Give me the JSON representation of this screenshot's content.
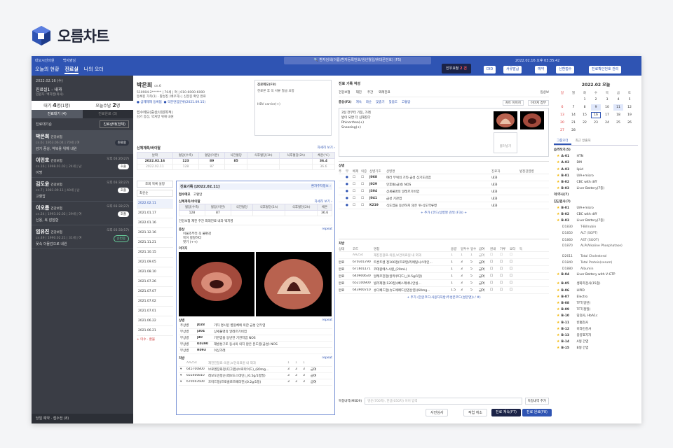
{
  "brand": {
    "name": "오름차트",
    "colors": {
      "primary": "#2f54b3",
      "dark": "#3a3d45"
    }
  },
  "topbar": {
    "hospital": "대오시선의원",
    "user": "백지영님",
    "tabs": [
      "오늘의 현황",
      "진료실",
      "나의 오더"
    ],
    "active_tab": "진료실",
    "search_placeholder": "🔍 환자검색(이름/환자등록번호/생년월일/휴대폰번호) (F5)",
    "time": "2022.02.16 오후 03:35:42",
    "emergency_prefix": "인우요청",
    "emergency_count": "2 건",
    "buttons": [
      "DID",
      "서류발급",
      "예약",
      "신환접수",
      "진료확인번호 관리"
    ]
  },
  "sidebar": {
    "date": "2022.02.16 (수)",
    "room": "진료실1 - 내과",
    "room_sub": "입원자: 백지영(의사)",
    "counts": [
      {
        "label": "대기",
        "value": "4",
        "suffix": "명",
        "extra": "(1명)"
      },
      {
        "label": "오늘수납",
        "value": "2",
        "suffix": "명"
      }
    ],
    "tabs": [
      "진료대기 (4)",
      "진료완료 (3)"
    ],
    "filter_label": "진료대기순",
    "filter_select": "진료상태(전체)",
    "patients": [
      {
        "name": "박은희",
        "ins": "건강보험",
        "info": "cn.6 | 1953.06.04 | 70세 | 여",
        "dx": "감기 증상, 약복용 위해 내원",
        "time": "",
        "badge": "진료중",
        "style": "dk"
      },
      {
        "name": "이민호",
        "ins": "건강보험",
        "info": "cn.16 | 1998.01.02 | 24세 | 남",
        "dx": "이명",
        "time": "오후 03:20(27)",
        "badge": "호출",
        "style": ""
      },
      {
        "name": "김도윤",
        "ins": "건강보험",
        "info": "cn.7 | 1981.09.11 | 40세 | 남",
        "dx": "고혈압",
        "time": "오후 03:32(27)",
        "badge": "호출",
        "style": ""
      },
      {
        "name": "이오름",
        "ins": "건강보험",
        "info": "cn.24 | 1993.02.02 | 29세 | 여",
        "dx": "신용, 복 잡잡함",
        "time": "오후 03:32(27)",
        "badge": "호출",
        "style": ""
      },
      {
        "name": "임유진",
        "ins": "건강보험",
        "info": "cn.49 | 1990.02.21 | 31세 | 여",
        "dx": "꽃속 이물감으로 내원",
        "time": "오후 03:33(17)",
        "badge": "순번중",
        "style": "ol"
      }
    ],
    "footer": "당일 예약 · 접수전 (8)"
  },
  "patient": {
    "name": "박은희",
    "cn": "cn.6",
    "line1": "510904-2****** | 70세 | 여 | 010-6000-6000",
    "line2": "등록된 가족(1) · 활성진 (배우자) | 신분증 확인 완료",
    "tags": [
      "금제제재 등록됨",
      "약분면임분류(2021.09.15)"
    ],
    "memo_label": "진료메모(F8)",
    "memo_text": "진료본 후 꼭 서류 발급 요청",
    "hbv": "HBV carrier(+)",
    "symptom_label": "접수메모(증상/내원목적)",
    "symptom": "감기 증상, 약처방 위해 내원"
  },
  "vitals": {
    "title": "신체계측/바이탈",
    "link": "자세히 보기 ›",
    "headers": [
      "날짜",
      "혈압(수축)",
      "혈압(이완)",
      "식전혈당",
      "식후혈당(1h)",
      "식후혈당(2h)",
      "체온(℃)"
    ],
    "rows": [
      [
        "2022.02.16",
        "123",
        "89",
        "85",
        "",
        "",
        "36.4"
      ],
      [
        "2022.02.11",
        "128",
        "87",
        "",
        "",
        "",
        "36.6"
      ]
    ]
  },
  "history": {
    "btn": "조회 목록 설정",
    "sort": "최신순",
    "dates": [
      "2022.02.11",
      "2021.01.17",
      "2022.01.16",
      "2021.12.16",
      "2021.11.21",
      "2021.10.15",
      "2021.09.05",
      "2021.08.10",
      "2021.07.26",
      "2021.07.07",
      "2021.07.02",
      "2021.07.01",
      "2021.06.22",
      "2021.06.21"
    ],
    "footer": "+ 미수 · 환불"
  },
  "record": {
    "title": "진료기록 [2022.02.11]",
    "link": "환자주차정보 ›",
    "memo_label": "접수메모",
    "memo": "고혈압",
    "vital_title": "신체계측/바이탈",
    "vital_link": "자세히 보기 ›",
    "vital_headers": [
      "혈압(수축)",
      "혈압(이완)",
      "식전혈당",
      "식후혈당(1h)",
      "식후혈당(2h)",
      "체온"
    ],
    "vital_row": [
      "128",
      "87",
      "",
      "",
      "",
      "36.6"
    ],
    "ins_line": "건강보험 재진 주간 외래진료 내과 백지영",
    "sx_label": "증상",
    "sx_repeat": "repeat",
    "sx": [
      "이물조부터 꼭 불편감",
      "목이 칼칼하다",
      "핏기 (++)"
    ],
    "img_label": "이미지",
    "dx_label": "상병",
    "dx_repeat": "repeat",
    "dx": [
      [
        "주상병",
        "J028",
        "기타 명시된 병원체에 의한 급성 인두염"
      ],
      [
        "부상병",
        "J304",
        "상세불명의 알레르기비염"
      ],
      [
        "부상병",
        "J40",
        "기관염을 동반한 기관지염 NOS"
      ],
      [
        "부상병",
        "K0390",
        "재발성구토 동시의 의지 않은 분도염(급성) NOS"
      ],
      [
        "부상병",
        "R093",
        "이상가래"
      ]
    ],
    "rx_label": "처방",
    "rx_repeat": "repeat",
    "rx": [
      [
        "",
        "AA254",
        "재진진찰료-의원,보건의료원 내 외과",
        "1",
        "1",
        "1",
        ""
      ],
      [
        "▾",
        "645700800",
        "브로멘장화정(디그램)(브로마이드)_(80mg...",
        "3",
        "3",
        "3",
        "급여"
      ],
      [
        "▾",
        "655400810",
        "레보도민정순(레보도스데민)_(0.5g/1정발)",
        "3",
        "3",
        "3",
        "급여"
      ],
      [
        "▾",
        "670503500",
        "흐미드정(프로클로르페라진)(0.2g/1정)",
        "3",
        "3",
        "3",
        "급여"
      ]
    ]
  },
  "note": {
    "title": "진료 기록 작성",
    "ins": "건강보험",
    "visit": "재진",
    "time": "주간",
    "dept": "외래진료",
    "doc": "임상보",
    "sx_label": "증상(F2)",
    "sx_toolbar": [
      "계속",
      "화순",
      "맞춤기",
      "맞춤도",
      "고혈압"
    ],
    "sx": [
      "3일 전부터 기침, 가래",
      "밤이 되면 더 심해진다",
      "Rhinorrhea(+)",
      "Sneezing(+)"
    ],
    "chart_btn": "차트 이미지",
    "img_btn": "이미지 첨부",
    "attach": "불러넣기",
    "dx_label": "상병",
    "dx_headers": [
      "주",
      "부",
      "배제",
      "의증",
      "상병기호",
      "상병명",
      "진료과",
      "법정감염병"
    ],
    "dx": [
      [
        "●",
        "J068",
        "여러 부위의 기타 급성 상기도감염",
        "내과"
      ],
      [
        "●",
        "J029",
        "인후통(급성) NOS",
        "내과"
      ],
      [
        "●",
        "J304",
        "상세불명의 알레르기비염",
        "내과"
      ],
      [
        "●",
        "J041",
        "급성 기관염",
        "내과"
      ],
      [
        "●",
        "K219",
        "식도염을 동반하지 않은 위-식도역류병",
        "내과"
      ]
    ],
    "dx_add": "+ 추가 (코드/상병명 검색 (F3)) +",
    "rx_label": "처방",
    "rx_headers": [
      "상태",
      "코드",
      "명칭",
      "용량",
      "일투수",
      "일수",
      "급여",
      "원내",
      "가루",
      "요타",
      "득"
    ],
    "rx": [
      [
        "",
        "AA254",
        "재진진찰료-의원,보건의료원 내 외과",
        "1",
        "1",
        "1",
        "급여"
      ],
      [
        "완료",
        "670301790",
        "트론트렌 정100정(트로텐/리에틸시스테인...",
        "1",
        "3",
        "5",
        "급여"
      ],
      [
        "완료",
        "671601171",
        "코데원에스시럽_(20mL)",
        "1",
        "3",
        "5",
        "급여"
      ],
      [
        "완료",
        "640900630",
        "알레르진정(알라쿠디드)_(0.5g/1정)",
        "1",
        "3",
        "5",
        "급여"
      ],
      [
        "완료",
        "652100900",
        "빌리제정(120정)(뻬스레네니안실...",
        "1",
        "3",
        "5",
        "급여"
      ],
      [
        "완료",
        "643900710",
        "슈다페드정(슈도에페드린염산염)(60mg...",
        "1.5",
        "3",
        "5",
        "급여"
      ]
    ],
    "rx_add": "+ 추가 (한글코드/사용자처방/주성분코드(성분명)) / #)",
    "special_label": "특정내역(MSD9)",
    "special_placeholder": "명운(700차), 한글(050차) 이어 입력",
    "special_btn": "특정내역 추가",
    "btn_photo": "사진심사",
    "btn_cancel": "작업 취소",
    "btn_save": "진료 계속(F7)",
    "btn_done": "진료 완료(F8)"
  },
  "calendar": {
    "title": "2022.02 오늘",
    "days": [
      "일",
      "월",
      "화",
      "수",
      "목",
      "금",
      "토"
    ],
    "weeks": [
      [
        "",
        "",
        "1",
        "2",
        "3",
        "4",
        "5"
      ],
      [
        "6",
        "7",
        "8",
        "9",
        "10",
        "11",
        "12"
      ],
      [
        "13",
        "14",
        "15",
        "16",
        "17",
        "18",
        "19"
      ],
      [
        "20",
        "21",
        "22",
        "23",
        "24",
        "25",
        "26"
      ],
      [
        "27",
        "28",
        "",
        "",
        "",
        "",
        "",
        "",
        ""
      ]
    ]
  },
  "orders": {
    "tabs": [
      "그룹오더",
      "최근 방출처"
    ],
    "groups": [
      {
        "title": "습격작기(5)",
        "items": [
          [
            "A-01",
            "HTN"
          ],
          [
            "A-02",
            "DM"
          ],
          [
            "A-03",
            "lipid"
          ],
          [
            "B-01",
            "U/A+micro"
          ],
          [
            "B-02",
            "CBC with diff"
          ],
          [
            "B-03",
            "Liver Battery(7종)"
          ]
        ]
      },
      {
        "title": "약/주사(7)",
        "items": []
      },
      {
        "title": "진단검사(7)",
        "items": [
          [
            "B-01",
            "U/A+micro"
          ],
          [
            "B-02",
            "CBC with diff"
          ],
          [
            "B-03",
            "Liver Battery(7종)"
          ]
        ]
      }
    ],
    "labs": [
      [
        "D1830",
        "T-Billrubin"
      ],
      [
        "D1850",
        "ALT (SGPT)"
      ],
      [
        "D1860",
        "AST (SGOT)"
      ],
      [
        "D1870",
        "ALP(Alkaline Phosphatase)"
      ],
      [
        "D2611",
        "Total Cholesterol"
      ],
      [
        "D1840",
        "Total Protein(serum)"
      ],
      [
        "D1880",
        "Albumin"
      ]
    ],
    "more": [
      [
        "B-04",
        "Liver Battery with V-GTP"
      ],
      [
        "B-05",
        "생화학검사(15종)"
      ],
      [
        "B-06",
        "LIPID"
      ],
      [
        "B-07",
        "Electro"
      ],
      [
        "B-08",
        "TFT(일반)"
      ],
      [
        "B-09",
        "TFT(정밀)"
      ],
      [
        "B-10",
        "당검사, HbA1c"
      ],
      [
        "B-11",
        "빈혈검사"
      ],
      [
        "B-12",
        "비타민검사"
      ],
      [
        "B-13",
        "종양표지자"
      ],
      [
        "B-14",
        "A형 간염"
      ],
      [
        "B-15",
        "B형 간염"
      ]
    ]
  }
}
